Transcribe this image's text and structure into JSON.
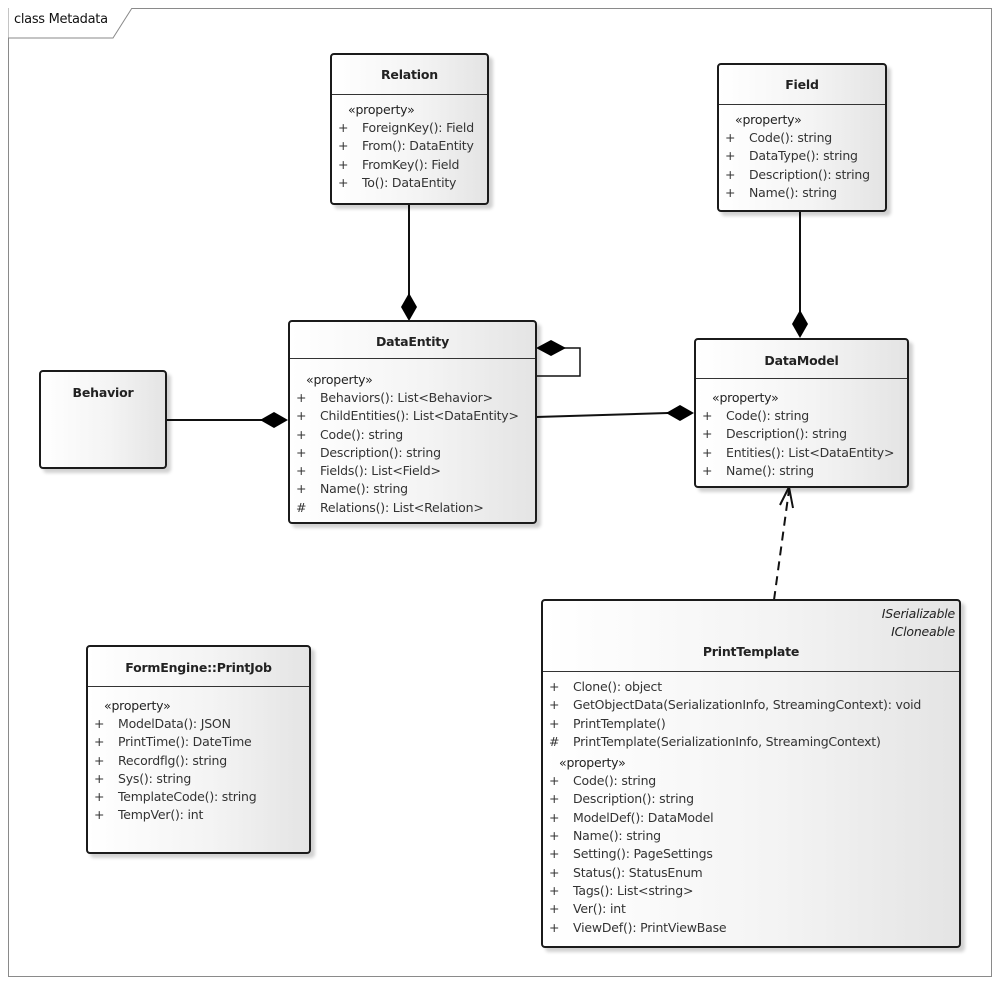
{
  "diagram": {
    "title": "class Metadata",
    "classes": {
      "relation": {
        "name": "Relation",
        "stereotype": "«property»",
        "members": [
          {
            "vis": "+",
            "sig": "ForeignKey(): Field"
          },
          {
            "vis": "+",
            "sig": "From(): DataEntity"
          },
          {
            "vis": "+",
            "sig": "FromKey(): Field"
          },
          {
            "vis": "+",
            "sig": "To(): DataEntity"
          }
        ]
      },
      "field": {
        "name": "Field",
        "stereotype": "«property»",
        "members": [
          {
            "vis": "+",
            "sig": "Code(): string"
          },
          {
            "vis": "+",
            "sig": "DataType(): string"
          },
          {
            "vis": "+",
            "sig": "Description(): string"
          },
          {
            "vis": "+",
            "sig": "Name(): string"
          }
        ]
      },
      "data_entity": {
        "name": "DataEntity",
        "stereotype": "«property»",
        "members": [
          {
            "vis": "+",
            "sig": "Behaviors(): List<Behavior>"
          },
          {
            "vis": "+",
            "sig": "ChildEntities(): List<DataEntity>"
          },
          {
            "vis": "+",
            "sig": "Code(): string"
          },
          {
            "vis": "+",
            "sig": "Description(): string"
          },
          {
            "vis": "+",
            "sig": "Fields(): List<Field>"
          },
          {
            "vis": "+",
            "sig": "Name(): string"
          },
          {
            "vis": "#",
            "sig": "Relations(): List<Relation>"
          }
        ]
      },
      "data_model": {
        "name": "DataModel",
        "stereotype": "«property»",
        "members": [
          {
            "vis": "+",
            "sig": "Code(): string"
          },
          {
            "vis": "+",
            "sig": "Description(): string"
          },
          {
            "vis": "+",
            "sig": "Entities(): List<DataEntity>"
          },
          {
            "vis": "+",
            "sig": "Name(): string"
          }
        ]
      },
      "behavior": {
        "name": "Behavior"
      },
      "print_job": {
        "name": "FormEngine::PrintJob",
        "stereotype": "«property»",
        "members": [
          {
            "vis": "+",
            "sig": "ModelData(): JSON"
          },
          {
            "vis": "+",
            "sig": "PrintTime(): DateTime"
          },
          {
            "vis": "+",
            "sig": "Recordflg(): string"
          },
          {
            "vis": "+",
            "sig": "Sys(): string"
          },
          {
            "vis": "+",
            "sig": "TemplateCode(): string"
          },
          {
            "vis": "+",
            "sig": "TempVer(): int"
          }
        ]
      },
      "print_template": {
        "name": "PrintTemplate",
        "interfaces": [
          "ISerializable",
          "ICloneable"
        ],
        "operations": [
          {
            "vis": "+",
            "sig": "Clone(): object"
          },
          {
            "vis": "+",
            "sig": "GetObjectData(SerializationInfo, StreamingContext): void"
          },
          {
            "vis": "+",
            "sig": "PrintTemplate()"
          },
          {
            "vis": "#",
            "sig": "PrintTemplate(SerializationInfo, StreamingContext)"
          }
        ],
        "stereotype": "«property»",
        "members": [
          {
            "vis": "+",
            "sig": "Code(): string"
          },
          {
            "vis": "+",
            "sig": "Description(): string"
          },
          {
            "vis": "+",
            "sig": "ModelDef(): DataModel"
          },
          {
            "vis": "+",
            "sig": "Name(): string"
          },
          {
            "vis": "+",
            "sig": "Setting(): PageSettings"
          },
          {
            "vis": "+",
            "sig": "Status(): StatusEnum"
          },
          {
            "vis": "+",
            "sig": "Tags(): List<string>"
          },
          {
            "vis": "+",
            "sig": "Ver(): int"
          },
          {
            "vis": "+",
            "sig": "ViewDef(): PrintViewBase"
          }
        ]
      }
    },
    "relationships": [
      {
        "type": "composition",
        "from": "Relation",
        "to": "DataEntity"
      },
      {
        "type": "composition",
        "from": "Field",
        "to": "DataModel"
      },
      {
        "type": "composition",
        "from": "Behavior",
        "to": "DataEntity"
      },
      {
        "type": "composition",
        "from": "DataEntity",
        "to": "DataEntity"
      },
      {
        "type": "composition",
        "from": "DataEntity",
        "to": "DataModel"
      },
      {
        "type": "dependency",
        "from": "PrintTemplate",
        "to": "DataModel"
      }
    ]
  }
}
